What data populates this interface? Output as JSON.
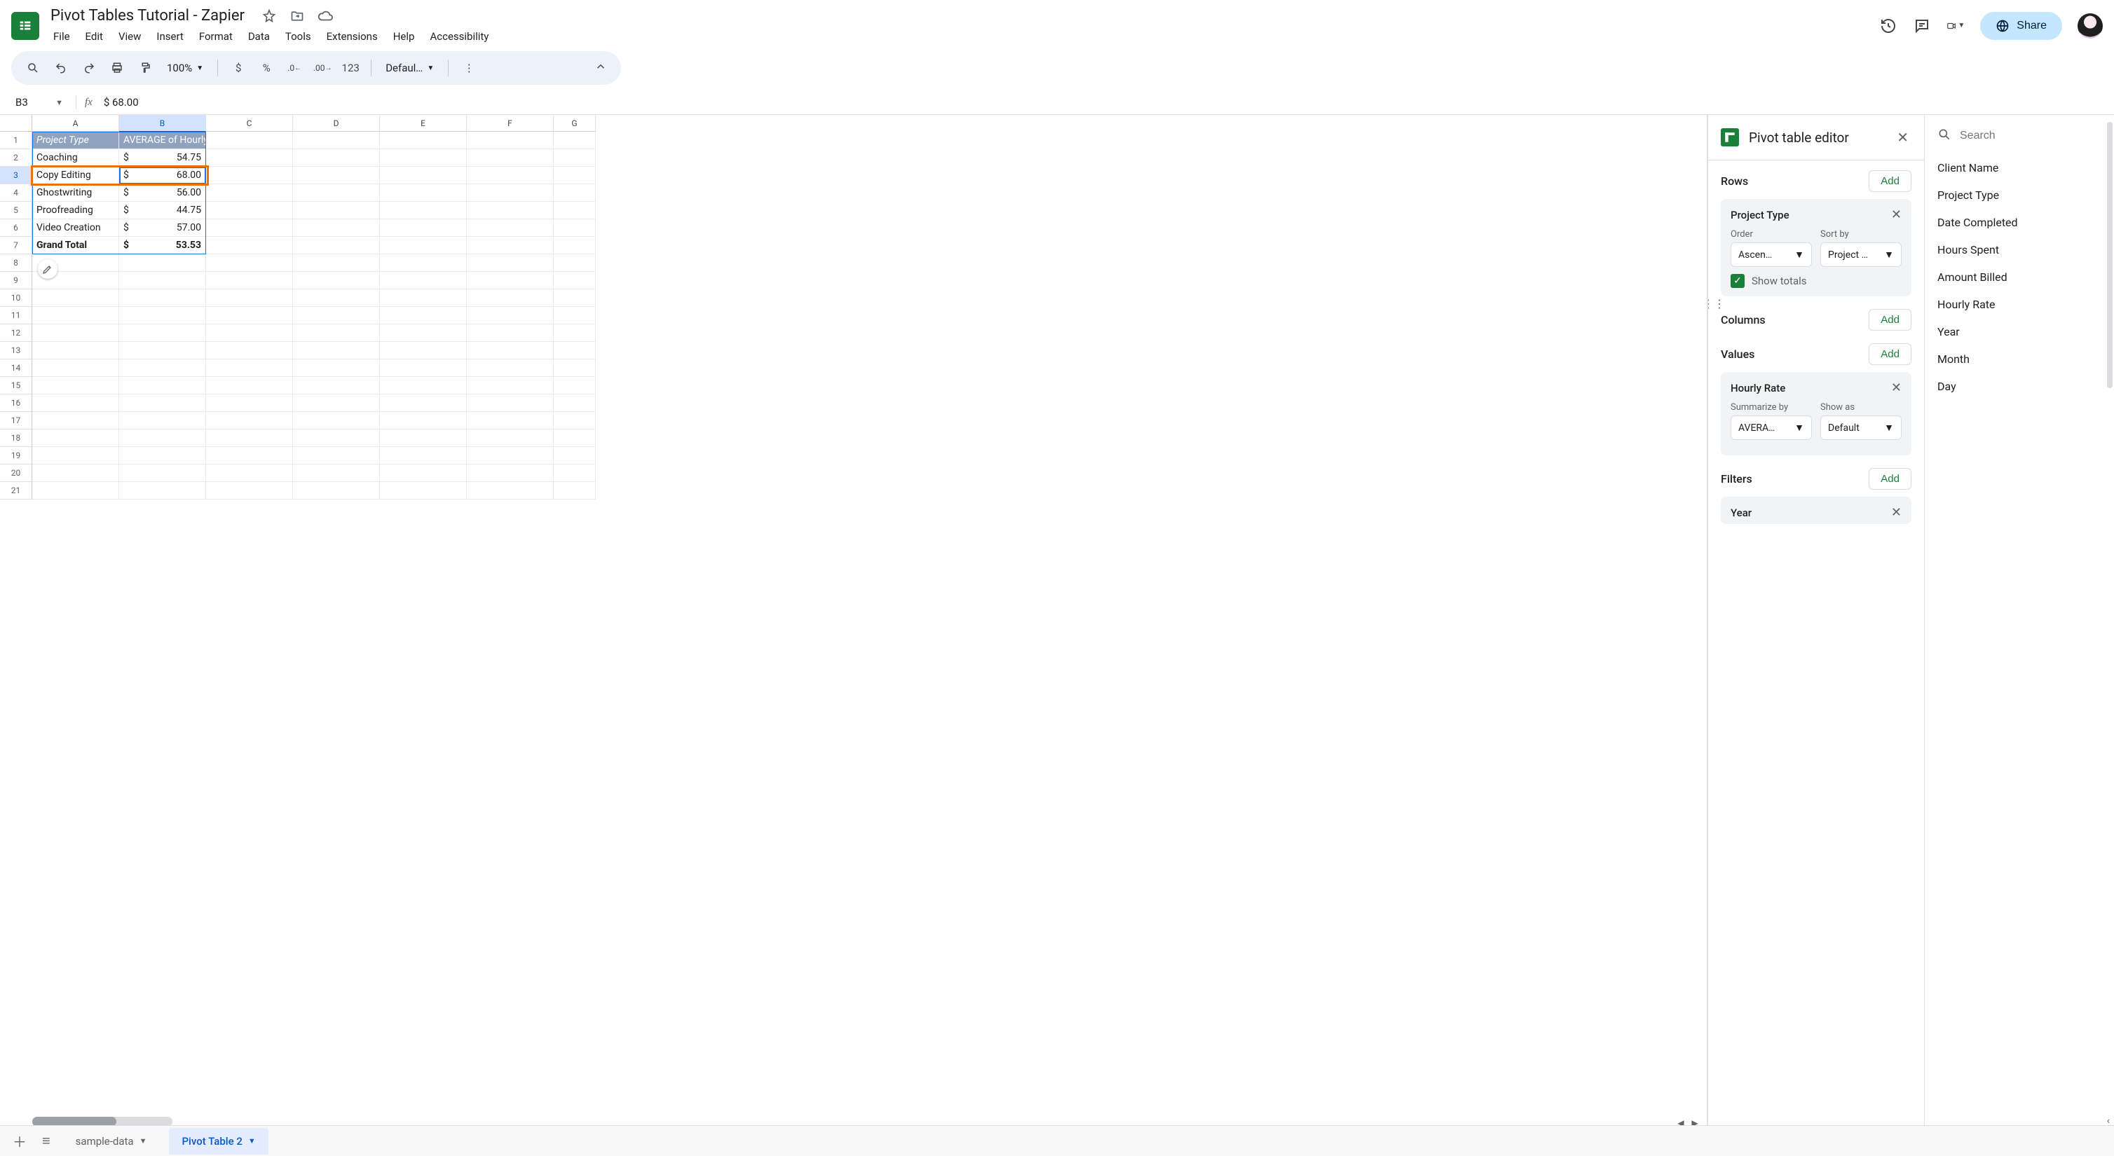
{
  "doc_title": "Pivot Tables Tutorial - Zapier",
  "menus": [
    "File",
    "Edit",
    "View",
    "Insert",
    "Format",
    "Data",
    "Tools",
    "Extensions",
    "Help",
    "Accessibility"
  ],
  "toolbar": {
    "zoom": "100%",
    "font": "Defaul…",
    "num123": "123"
  },
  "namebox": "B3",
  "formula": "$ 68.00",
  "share_label": "Share",
  "columns": [
    "A",
    "B",
    "C",
    "D",
    "E",
    "F",
    "G"
  ],
  "grid": {
    "header": {
      "a": "Project Type",
      "b": "AVERAGE of Hourly Rate"
    },
    "rows": [
      {
        "a": "Coaching",
        "cur": "$",
        "b": "54.75"
      },
      {
        "a": "Copy Editing",
        "cur": "$",
        "b": "68.00"
      },
      {
        "a": "Ghostwriting",
        "cur": "$",
        "b": "56.00"
      },
      {
        "a": "Proofreading",
        "cur": "$",
        "b": "44.75"
      },
      {
        "a": "Video Creation",
        "cur": "$",
        "b": "57.00"
      }
    ],
    "total": {
      "a": "Grand Total",
      "cur": "$",
      "b": "53.53"
    }
  },
  "pivot": {
    "title": "Pivot table editor",
    "search_placeholder": "Search",
    "rows_label": "Rows",
    "columns_label": "Columns",
    "values_label": "Values",
    "filters_label": "Filters",
    "add": "Add",
    "fields": [
      "Client Name",
      "Project Type",
      "Date Completed",
      "Hours Spent",
      "Amount Billed",
      "Hourly Rate",
      "Year",
      "Month",
      "Day"
    ],
    "rows_card": {
      "title": "Project Type",
      "order_label": "Order",
      "order_val": "Ascen…",
      "sort_label": "Sort by",
      "sort_val": "Project …",
      "show_totals": "Show totals"
    },
    "values_card": {
      "title": "Hourly Rate",
      "sum_label": "Summarize by",
      "sum_val": "AVERA…",
      "show_label": "Show as",
      "show_val": "Default"
    },
    "filters_card": {
      "title": "Year"
    }
  },
  "tabs": {
    "add": "+",
    "all": "≡",
    "t1": "sample-data",
    "t2": "Pivot Table 2"
  }
}
